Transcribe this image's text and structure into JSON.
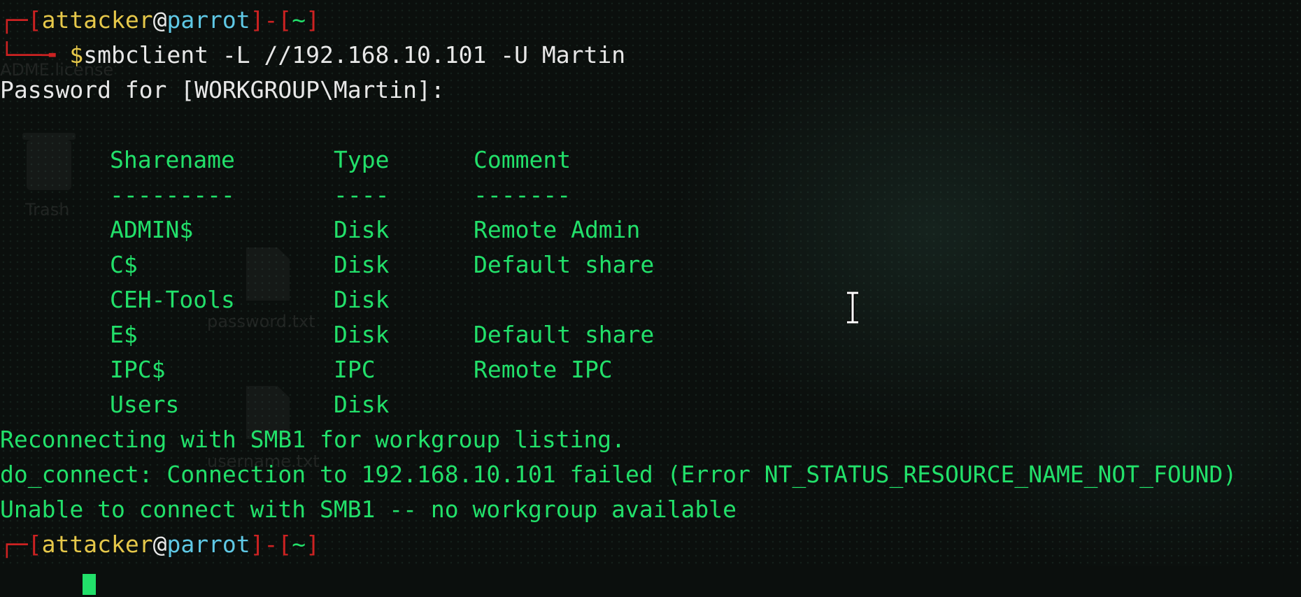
{
  "desktop": {
    "icons": [
      {
        "label": "ADME.license",
        "icon": "file-icon"
      },
      {
        "label": "Trash",
        "icon": "trash-icon"
      },
      {
        "label": "password.txt",
        "icon": "file-icon"
      },
      {
        "label": "username.txt",
        "icon": "file-icon"
      }
    ]
  },
  "prompt": {
    "open": "[",
    "user": "attacker",
    "at": "@",
    "host": "parrot",
    "close": "]",
    "dash": "-",
    "dir_open": "[",
    "dir": "~",
    "dir_close": "]",
    "symbol": "$"
  },
  "command": "smbclient -L //192.168.10.101 -U Martin",
  "password_prompt": "Password for [WORKGROUP\\Martin]:",
  "shares_table": {
    "headers": [
      "Sharename",
      "Type",
      "Comment"
    ],
    "separators": [
      "---------",
      "----",
      "-------"
    ],
    "rows": [
      [
        "ADMIN$",
        "Disk",
        "Remote Admin"
      ],
      [
        "C$",
        "Disk",
        "Default share"
      ],
      [
        "CEH-Tools",
        "Disk",
        ""
      ],
      [
        "E$",
        "Disk",
        "Default share"
      ],
      [
        "IPC$",
        "IPC",
        "Remote IPC"
      ],
      [
        "Users",
        "Disk",
        ""
      ]
    ]
  },
  "output_lines": [
    "Reconnecting with SMB1 for workgroup listing.",
    "do_connect: Connection to 192.168.10.101 failed (Error NT_STATUS_RESOURCE_NAME_NOT_FOUND)",
    "Unable to connect with SMB1 -- no workgroup available"
  ],
  "colors": {
    "text": "#22e06a",
    "prompt_frame": "#cc2222",
    "user": "#e6c84a",
    "host": "#5fc9e6",
    "background": "#0b0f0d"
  }
}
